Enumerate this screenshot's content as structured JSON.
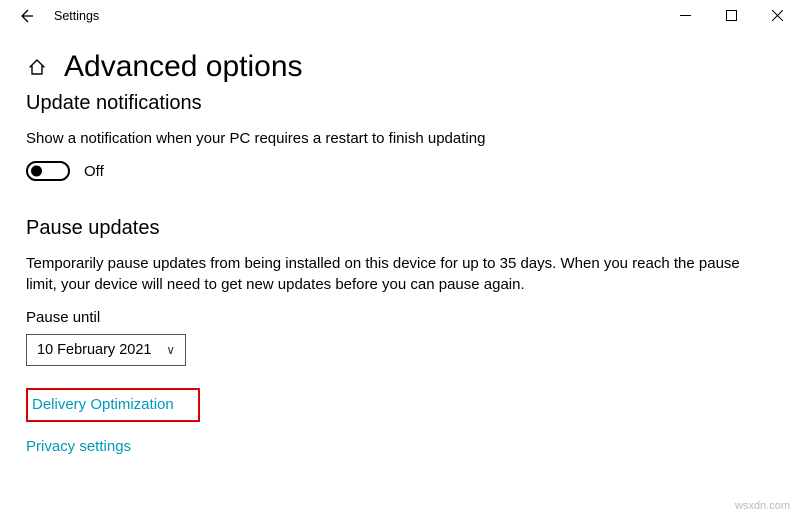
{
  "window": {
    "title": "Settings"
  },
  "page": {
    "title": "Advanced options"
  },
  "notifications": {
    "heading": "Update notifications",
    "description": "Show a notification when your PC requires a restart to finish updating",
    "toggle_state": "Off"
  },
  "pause": {
    "heading": "Pause updates",
    "description": "Temporarily pause updates from being installed on this device for up to 35 days. When you reach the pause limit, your device will need to get new updates before you can pause again.",
    "field_label": "Pause until",
    "selected_date": "10 February 2021"
  },
  "links": {
    "delivery_optimization": "Delivery Optimization",
    "privacy_settings": "Privacy settings"
  },
  "watermark": "wsxdn.com"
}
